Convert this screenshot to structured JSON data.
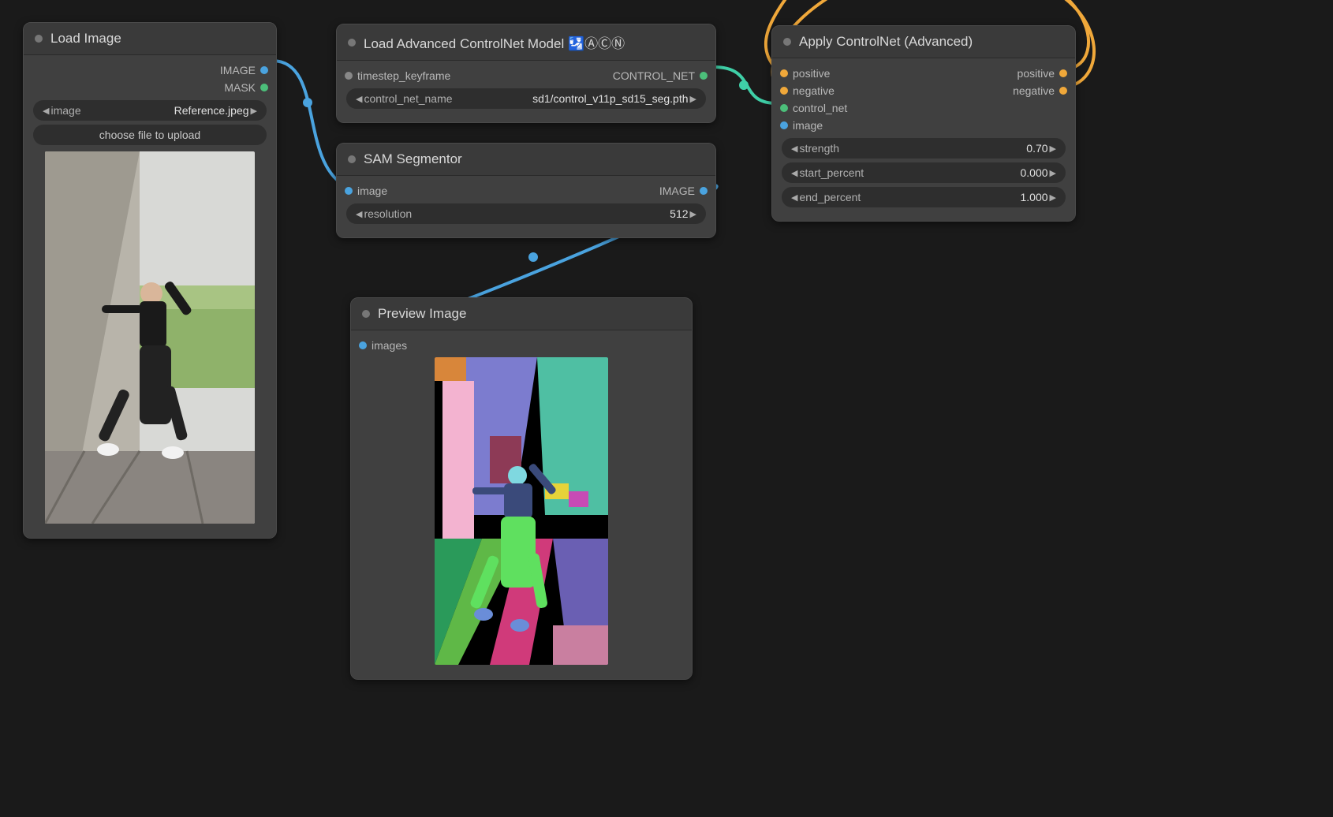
{
  "nodes": {
    "load_image": {
      "title": "Load Image",
      "outputs": {
        "image": "IMAGE",
        "mask": "MASK"
      },
      "widgets": {
        "image_label": "image",
        "image_value": "Reference.jpeg",
        "upload_label": "choose file to upload"
      }
    },
    "load_controlnet": {
      "title": "Load Advanced ControlNet Model 🛂ⒶⒸⓃ",
      "inputs": {
        "timestep_keyframe": "timestep_keyframe"
      },
      "outputs": {
        "control_net": "CONTROL_NET"
      },
      "widgets": {
        "name_label": "control_net_name",
        "name_value": "sd1/control_v11p_sd15_seg.pth"
      }
    },
    "sam": {
      "title": "SAM Segmentor",
      "inputs": {
        "image": "image"
      },
      "outputs": {
        "image": "IMAGE"
      },
      "widgets": {
        "res_label": "resolution",
        "res_value": "512"
      }
    },
    "preview": {
      "title": "Preview Image",
      "inputs": {
        "images": "images"
      }
    },
    "apply_cn": {
      "title": "Apply ControlNet (Advanced)",
      "inputs": {
        "positive": "positive",
        "negative": "negative",
        "control_net": "control_net",
        "image": "image"
      },
      "outputs": {
        "positive": "positive",
        "negative": "negative"
      },
      "widgets": {
        "strength_label": "strength",
        "strength_value": "0.70",
        "start_label": "start_percent",
        "start_value": "0.000",
        "end_label": "end_percent",
        "end_value": "1.000"
      }
    }
  },
  "badges": {
    "blue": "↯",
    "a": "A",
    "c": "C",
    "n": "N"
  }
}
